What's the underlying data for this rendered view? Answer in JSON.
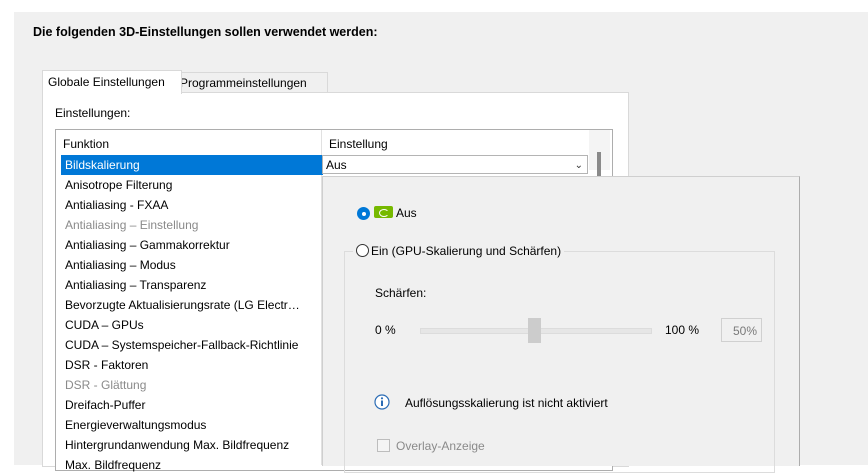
{
  "heading": "Die folgenden 3D-Einstellungen sollen verwendet werden:",
  "tabs": [
    {
      "label": "Globale Einstellungen",
      "active": true
    },
    {
      "label": "Programmeinstellungen",
      "active": false
    }
  ],
  "settings_label": "Einstellungen:",
  "columns": {
    "function": "Funktion",
    "setting": "Einstellung"
  },
  "rows": [
    {
      "label": "Bildskalierung",
      "state": "selected"
    },
    {
      "label": "Anisotrope Filterung"
    },
    {
      "label": "Antialiasing - FXAA"
    },
    {
      "label": "Antialiasing – Einstellung",
      "state": "disabled"
    },
    {
      "label": "Antialiasing – Gammakorrektur"
    },
    {
      "label": "Antialiasing – Modus"
    },
    {
      "label": "Antialiasing – Transparenz"
    },
    {
      "label": "Bevorzugte Aktualisierungsrate (LG Electr…"
    },
    {
      "label": "CUDA – GPUs"
    },
    {
      "label": "CUDA – Systemspeicher-Fallback-Richtlinie"
    },
    {
      "label": "DSR - Faktoren"
    },
    {
      "label": "DSR - Glättung",
      "state": "disabled"
    },
    {
      "label": "Dreifach-Puffer"
    },
    {
      "label": "Energieverwaltungsmodus"
    },
    {
      "label": "Hintergrundanwendung Max. Bildfrequenz"
    },
    {
      "label": "Max. Bildfrequenz"
    }
  ],
  "selected_value": "Aus",
  "panel": {
    "option_off": "Aus",
    "option_on": "Ein (GPU-Skalierung und Schärfen)",
    "sharpen_label": "Schärfen:",
    "slider_min": "0 %",
    "slider_max": "100 %",
    "slider_value": "50%",
    "slider_level": 0.5,
    "info_text": "Auflösungsskalierung ist nicht aktiviert",
    "overlay_label": "Overlay-Anzeige"
  },
  "colors": {
    "selection": "#0078d7",
    "gpu_logo": "#76b900"
  }
}
